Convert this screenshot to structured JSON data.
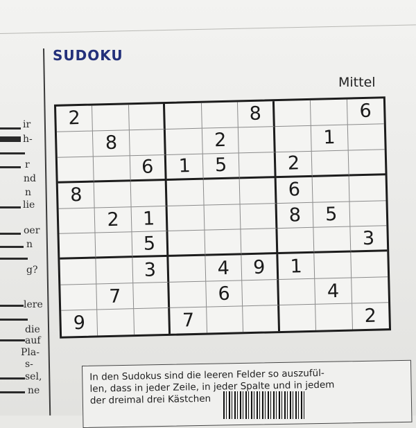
{
  "header": {
    "title": "SUDOKU",
    "difficulty": "Mittel"
  },
  "left_fragments": [
    "ir",
    "h-",
    "r",
    "nd",
    "n",
    "lie",
    "oer",
    "n",
    "g?",
    "lere",
    "die",
    "auf",
    "Pla-",
    "s-",
    "sel,",
    "ne"
  ],
  "grid": [
    [
      "2",
      "",
      "",
      "",
      "",
      "8",
      "",
      "",
      "6"
    ],
    [
      "",
      "8",
      "",
      "",
      "2",
      "",
      "",
      "1",
      ""
    ],
    [
      "",
      "",
      "6",
      "1",
      "5",
      "",
      "2",
      "",
      ""
    ],
    [
      "8",
      "",
      "",
      "",
      "",
      "",
      "6",
      "",
      ""
    ],
    [
      "",
      "2",
      "1",
      "",
      "",
      "",
      "8",
      "5",
      ""
    ],
    [
      "",
      "",
      "5",
      "",
      "",
      "",
      "",
      "",
      "3"
    ],
    [
      "",
      "",
      "3",
      "",
      "4",
      "9",
      "1",
      "",
      ""
    ],
    [
      "",
      "7",
      "",
      "",
      "6",
      "",
      "",
      "4",
      ""
    ],
    [
      "9",
      "",
      "",
      "7",
      "",
      "",
      "",
      "",
      "2"
    ]
  ],
  "instructions": {
    "line1": "In den Sudokus sind die leeren Felder so auszufül-",
    "line2": "len, dass in jeder Zeile, in jeder Spalte und in jedem",
    "line3": "der dreimal drei Kästchen"
  }
}
